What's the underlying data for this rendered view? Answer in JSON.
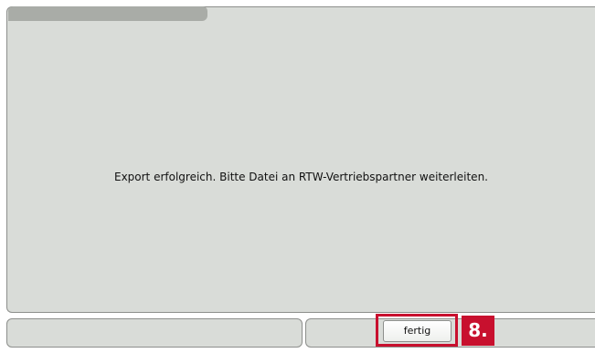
{
  "main": {
    "message": "Export erfolgreich. Bitte Datei an RTW-Vertriebspartner weiterleiten."
  },
  "footer": {
    "done_label": "fertig"
  },
  "annotation": {
    "step_label": "8.",
    "highlight_color": "#c8102e"
  },
  "colors": {
    "panel_bg": "#d9dcd8",
    "tab_strip": "#a9aca7",
    "border": "#8d8f8c"
  }
}
